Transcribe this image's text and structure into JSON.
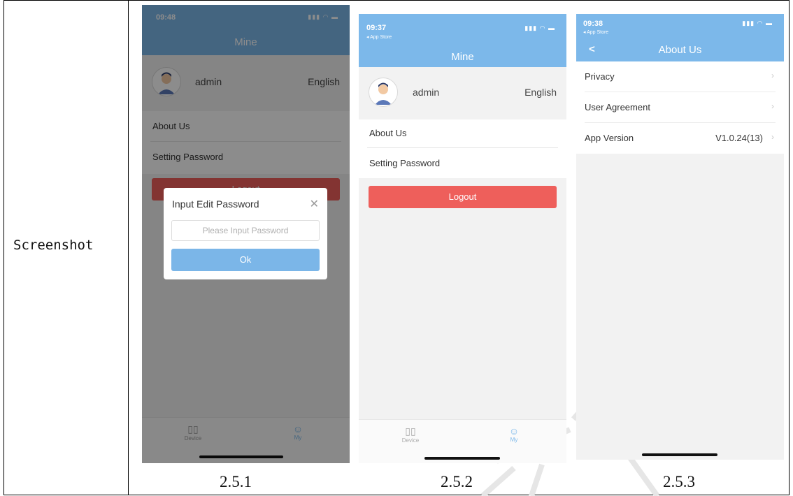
{
  "doc": {
    "row_label": "Screenshot",
    "captions": [
      "2.5.1",
      "2.5.2",
      "2.5.3"
    ]
  },
  "colors": {
    "nav_blue": "#7cb8ea",
    "logout_red": "#ee5f5b",
    "ok_blue": "#7bb6e8"
  },
  "phone1": {
    "status_time": "09:48",
    "status_icons": "signal-wifi-battery",
    "nav_title": "Mine",
    "user_name": "admin",
    "language": "English",
    "menu": [
      "About Us",
      "Setting Password"
    ],
    "logout_label": "Logout",
    "dialog": {
      "title": "Input Edit Password",
      "placeholder": "Please Input Password",
      "ok_label": "Ok"
    },
    "tabs": [
      {
        "label": "Device",
        "icon": "device-icon"
      },
      {
        "label": "My",
        "icon": "user-icon"
      }
    ]
  },
  "phone2": {
    "status_time": "09:37",
    "back_app": "◂ App Store",
    "nav_title": "Mine",
    "user_name": "admin",
    "language": "English",
    "menu": [
      "About Us",
      "Setting Password"
    ],
    "logout_label": "Logout",
    "tabs": [
      {
        "label": "Device",
        "icon": "device-icon"
      },
      {
        "label": "My",
        "icon": "user-icon"
      }
    ]
  },
  "phone3": {
    "status_time": "09:38",
    "back_app": "◂ App Store",
    "nav_back": "<",
    "nav_title": "About Us",
    "rows": [
      {
        "label": "Privacy",
        "value": ""
      },
      {
        "label": "User Agreement",
        "value": ""
      },
      {
        "label": "App Version",
        "value": "V1.0.24(13)"
      }
    ]
  }
}
